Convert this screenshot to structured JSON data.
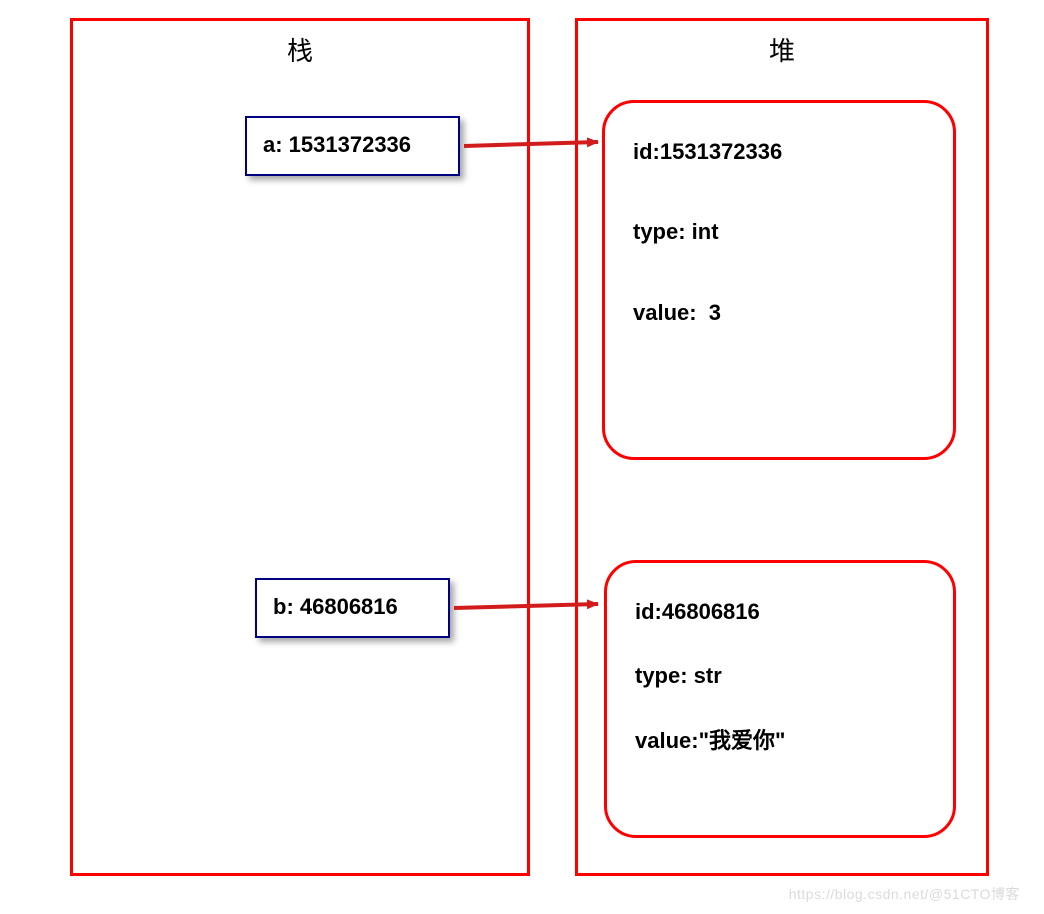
{
  "stack": {
    "title": "栈",
    "a_label": "a: 1531372336",
    "b_label": "b: 46806816"
  },
  "heap": {
    "title": "堆",
    "obj1": {
      "id_line": "id:1531372336",
      "type_line": "type: int",
      "value_line": "value:  3"
    },
    "obj2": {
      "id_line": "id:46806816",
      "type_line": "type: str",
      "value_line": "value:\"我爱你\""
    }
  },
  "watermark": "https://blog.csdn.net/@51CTO博客"
}
